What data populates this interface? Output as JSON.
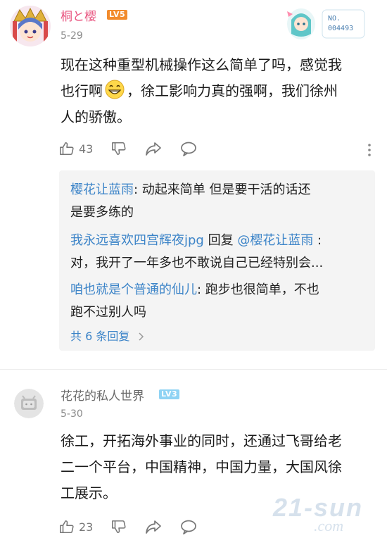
{
  "comments": [
    {
      "username": "桐と樱",
      "level": "LV5",
      "date": "5-29",
      "text_lines": [
        "现在这种重型机械操作这么简单了吗，感觉我",
        "也行啊",
        "，徐工影响力真的强啊，我们徐州",
        "人的骄傲。"
      ],
      "likes": "43",
      "medal_label": "NO.",
      "medal_number": "004493",
      "replies": [
        {
          "who": "樱花让蓝雨",
          "line1_rest": ": 动起来简单   但是要干活的话还",
          "line2": "是要多练的"
        },
        {
          "who": "我永远喜欢四宫辉夜jpg",
          "mid": " 回复 ",
          "target": "@樱花让蓝雨",
          "line1_rest": " :",
          "line2": "对，我开了一年多也不敢说自己已经特别会..."
        },
        {
          "who": "咱也就是个普通的仙儿",
          "line1_rest": ": 跑步也很简单，不也",
          "line2": "跑不过别人吗"
        }
      ],
      "more_replies": "共 6 条回复"
    },
    {
      "username": "花花的私人世界",
      "level": "LV3",
      "date": "5-30",
      "text_lines": [
        "徐工，开拓海外事业的同时，还通过飞哥给老",
        "二一个平台，中国精神，中国力量，大国风徐",
        "工展示。"
      ],
      "likes": "23"
    }
  ],
  "watermark": {
    "main": "21-sun",
    "sub": ".com"
  },
  "colors": {
    "username_pink": "#e8517d",
    "reply_blue": "#3c84c8",
    "lv5": "#f28b2c",
    "lv3": "#8fd3f4"
  },
  "icons": [
    "thumbs-up-icon",
    "thumbs-down-icon",
    "share-icon",
    "comment-icon",
    "more-vertical-icon",
    "chevron-right-icon"
  ]
}
